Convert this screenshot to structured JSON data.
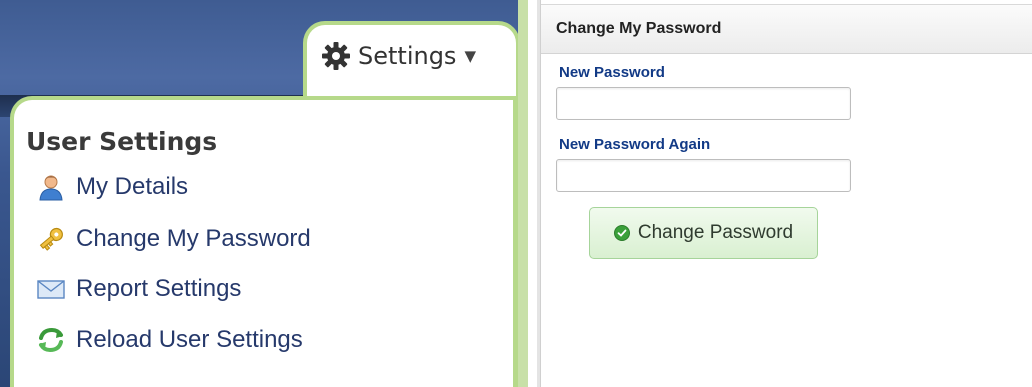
{
  "settings_tab": {
    "label": "Settings",
    "icon": "gear-icon",
    "caret": "▼"
  },
  "user_settings": {
    "title": "User Settings",
    "items": [
      {
        "label": "My Details",
        "icon": "user-icon"
      },
      {
        "label": "Change My Password",
        "icon": "key-icon"
      },
      {
        "label": "Report Settings",
        "icon": "envelope-icon"
      },
      {
        "label": "Reload User Settings",
        "icon": "reload-icon"
      }
    ]
  },
  "password_form": {
    "header": "Change My Password",
    "new_password_label": "New Password",
    "new_password_value": "",
    "new_password_again_label": "New Password Again",
    "new_password_again_value": "",
    "submit_label": "Change Password",
    "submit_icon": "check-circle-icon"
  },
  "colors": {
    "accent_green": "#b6d98a",
    "label_blue": "#123a86",
    "link_blue": "#26396b",
    "button_green": "#d9f0d1"
  }
}
